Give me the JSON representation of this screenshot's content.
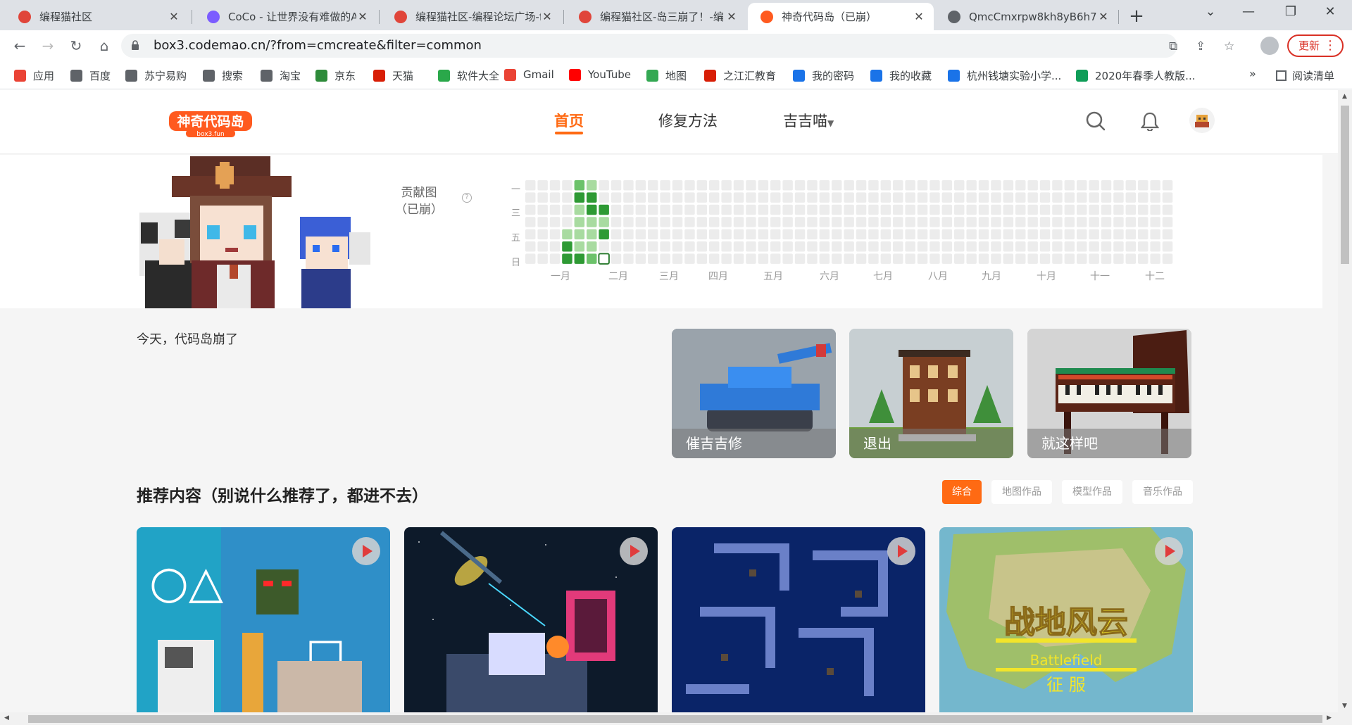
{
  "browser": {
    "tabs": [
      {
        "label": "编程猫社区",
        "favicon_color": "#e0453a"
      },
      {
        "label": "CoCo - 让世界没有难做的A",
        "favicon_color": "#7b5cff"
      },
      {
        "label": "编程猫社区-编程论坛广场-f",
        "favicon_color": "#e0453a"
      },
      {
        "label": "编程猫社区-岛三崩了！-编",
        "favicon_color": "#e0453a"
      },
      {
        "label": "神奇代码岛（已崩）",
        "favicon_color": "#ff5a1f"
      },
      {
        "label": "QmcCmxrpw8kh8yB6h7p",
        "favicon_color": "#5f6368"
      }
    ],
    "active_tab": 4,
    "url": "box3.codemao.cn/?from=cmcreate&filter=common",
    "update_label": "更新",
    "bookmarks": [
      {
        "label": "应用",
        "color": "#ea4335"
      },
      {
        "label": "百度",
        "color": "#5f6368"
      },
      {
        "label": "苏宁易购",
        "color": "#5f6368"
      },
      {
        "label": "搜索",
        "color": "#5f6368"
      },
      {
        "label": "淘宝",
        "color": "#5f6368"
      },
      {
        "label": "京东",
        "color": "#2e8b3a"
      },
      {
        "label": "天猫",
        "color": "#d81e06"
      },
      {
        "label": "软件大全",
        "color": "#2aa84a"
      },
      {
        "label": "Gmail",
        "color": "#ea4335"
      },
      {
        "label": "YouTube",
        "color": "#ff0000"
      },
      {
        "label": "地图",
        "color": "#34a853"
      },
      {
        "label": "之江汇教育",
        "color": "#d81e06"
      },
      {
        "label": "我的密码",
        "color": "#1a73e8"
      },
      {
        "label": "我的收藏",
        "color": "#1a73e8"
      },
      {
        "label": "杭州钱塘实验小学...",
        "color": "#1a73e8"
      },
      {
        "label": "2020年春季人教版...",
        "color": "#0f9d58"
      }
    ],
    "more_bookmarks": "»",
    "reading_list": "阅读清单"
  },
  "site": {
    "logo_text": "神奇代码岛",
    "logo_sub": "box3.fun",
    "nav": [
      {
        "label": "首页",
        "active": true
      },
      {
        "label": "修复方法",
        "active": false
      },
      {
        "label": "吉吉喵",
        "active": false
      }
    ],
    "accent_color": "#ff6a13",
    "icons": [
      "search-icon",
      "bell-icon",
      "user-avatar"
    ]
  },
  "profile": {
    "contrib_label_line1": "贡献图",
    "contrib_label_line2": "（已崩）",
    "help": "?",
    "day_labels": [
      "一",
      "三",
      "五",
      "日"
    ],
    "month_labels": [
      "一月",
      "二月",
      "三月",
      "四月",
      "五月",
      "六月",
      "七月",
      "八月",
      "九月",
      "十月",
      "十一",
      "十二"
    ],
    "contribution_levels": {
      "columns": 53,
      "rows": 7,
      "colors": [
        "#ececec",
        "#a8dba0",
        "#6cc26a",
        "#2e9a34"
      ],
      "active_cells": [
        {
          "col": 3,
          "row": 4,
          "level": 1
        },
        {
          "col": 3,
          "row": 5,
          "level": 3
        },
        {
          "col": 3,
          "row": 6,
          "level": 3
        },
        {
          "col": 4,
          "row": 0,
          "level": 2
        },
        {
          "col": 4,
          "row": 1,
          "level": 3
        },
        {
          "col": 4,
          "row": 2,
          "level": 1
        },
        {
          "col": 4,
          "row": 3,
          "level": 1
        },
        {
          "col": 4,
          "row": 4,
          "level": 1
        },
        {
          "col": 4,
          "row": 5,
          "level": 1
        },
        {
          "col": 4,
          "row": 6,
          "level": 3
        },
        {
          "col": 5,
          "row": 0,
          "level": 1
        },
        {
          "col": 5,
          "row": 1,
          "level": 3
        },
        {
          "col": 5,
          "row": 2,
          "level": 3
        },
        {
          "col": 5,
          "row": 3,
          "level": 1
        },
        {
          "col": 5,
          "row": 4,
          "level": 1
        },
        {
          "col": 5,
          "row": 5,
          "level": 1
        },
        {
          "col": 5,
          "row": 6,
          "level": 2
        },
        {
          "col": 6,
          "row": 2,
          "level": 3
        },
        {
          "col": 6,
          "row": 3,
          "level": 1
        },
        {
          "col": 6,
          "row": 4,
          "level": 3
        },
        {
          "col": 6,
          "row": 6,
          "level": 0,
          "today": true
        }
      ]
    }
  },
  "main": {
    "today_text": "今天，代码岛崩了",
    "feature_cards": [
      {
        "caption": "催吉吉修",
        "bg": "#8f9aa3"
      },
      {
        "caption": "退出",
        "bg": "#b8c2c5"
      },
      {
        "caption": "就这样吧",
        "bg": "#c9c9c9"
      }
    ],
    "section_title": "推荐内容（别说什么推荐了，都进不去）",
    "filters": [
      {
        "label": "综合",
        "active": true
      },
      {
        "label": "地图作品",
        "active": false
      },
      {
        "label": "模型作品",
        "active": false
      },
      {
        "label": "音乐作品",
        "active": false
      }
    ],
    "works": [
      {
        "title_art": "",
        "bg": "#2b7fb0"
      },
      {
        "title_art": "",
        "bg": "#0f1d2e"
      },
      {
        "title_art": "",
        "bg": "#0b2a6f"
      },
      {
        "title_art": "战地风云",
        "title_sub": "Battlefield",
        "title_sub2": "征  服",
        "bg": "#7fb2c4"
      }
    ]
  }
}
